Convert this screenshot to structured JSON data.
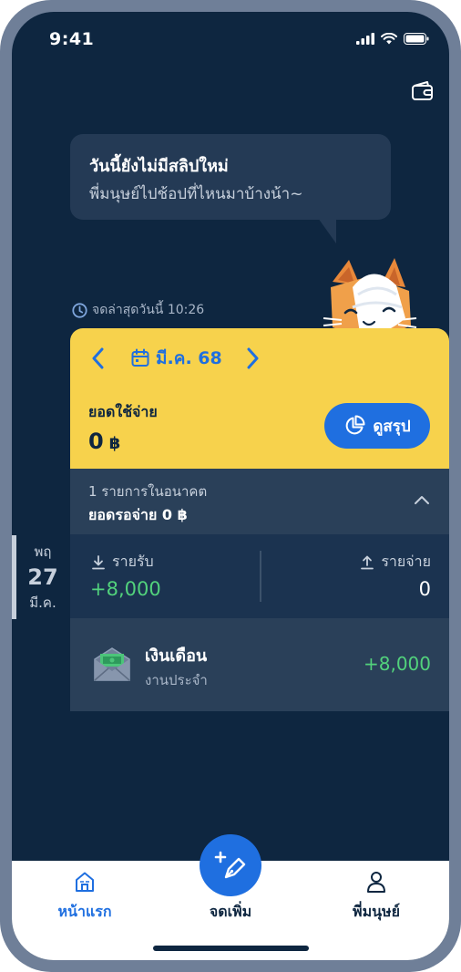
{
  "status_bar": {
    "time": "9:41"
  },
  "speech_bubble": {
    "title": "วันนี้ยังไม่มีสลิปใหม่",
    "subtitle": "พี่มนุษย์ไปช้อปที่ไหนมาบ้างน้า~"
  },
  "last_recorded": "จดล่าสุดวันนี้ 10:26",
  "side_date": {
    "weekday": "พฤ",
    "day": "27",
    "month": "มี.ค."
  },
  "month_card": {
    "month_label": "มี.ค. 68",
    "spend_label": "ยอดใช้จ่าย",
    "spend_value": "0",
    "currency": "฿",
    "summary_button": "ดูสรุป"
  },
  "future": {
    "line1": "1 รายการในอนาคต",
    "line2": "ยอดรอจ่าย 0 ฿"
  },
  "income_expense": {
    "income_label": "รายรับ",
    "income_value": "+8,000",
    "expense_label": "รายจ่าย",
    "expense_value": "0"
  },
  "transaction": {
    "title": "เงินเดือน",
    "subtitle": "งานประจำ",
    "amount": "+8,000"
  },
  "tabbar": {
    "home": "หน้าแรก",
    "add": "จดเพิ่ม",
    "profile": "พี่มนุษย์"
  },
  "colors": {
    "background": "#0e2640",
    "accent": "#1f6fe0",
    "card_yellow": "#f7d24c",
    "income_green": "#52d27c"
  }
}
